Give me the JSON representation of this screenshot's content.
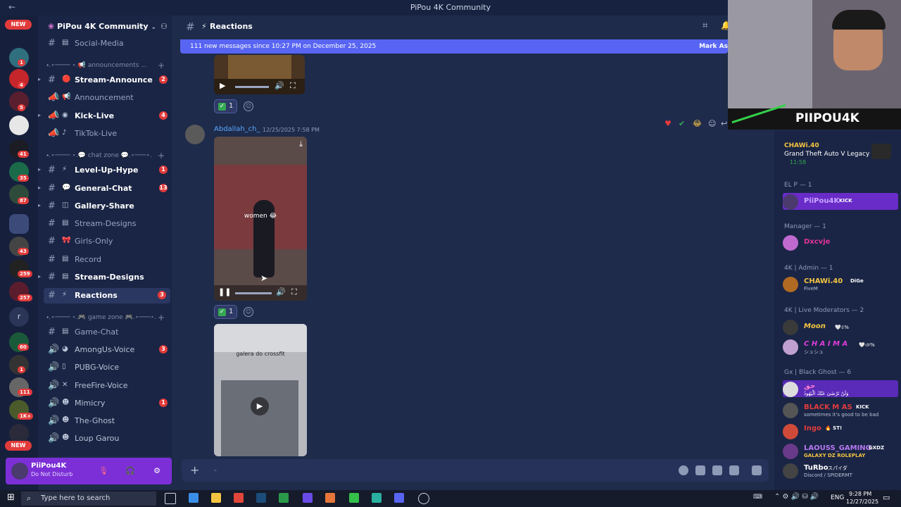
{
  "window": {
    "title": "PiPou 4K Community"
  },
  "server": {
    "name": "PiPou 4K Community"
  },
  "rail": {
    "new_label_top": "NEW",
    "new_label_bottom": "NEW",
    "badges": [
      "1",
      "4",
      "5",
      "41",
      "35",
      "87",
      "43",
      "259",
      "257",
      "60",
      "1",
      "111",
      "1K+"
    ],
    "letter": "r"
  },
  "channels": {
    "social": "Social-Media",
    "cat_announcements": "⬩.⋆──── ⋆.📢 announcements ...",
    "stream_announce": "Stream-Announce",
    "announcement": "Announcement",
    "kick_live": "Kick-Live",
    "tiktok_live": "TikTok-Live",
    "cat_chat": "⬩.⋆──── ⋆.💬 chat zone 💬.⋆───⋆.",
    "level_up": "Level-Up-Hype",
    "general_chat": "General-Chat",
    "gallery": "Gallery-Share",
    "stream_designs": "Stream-Designs",
    "girls_only": "Girls-Only",
    "record": "Record",
    "stream_designs2": "Stream-Designs",
    "reactions": "Reactions",
    "cat_game": "⬩.⋆──── ⋆.🎮 game zone 🎮.⋆───⋆.",
    "game_chat": "Game-Chat",
    "amongus": "AmongUs-Voice",
    "pubg": "PUBG-Voice",
    "freefire": "FreeFire-Voice",
    "mimicry": "Mimicry",
    "the_ghost": "The-Ghost",
    "loup": "Loup Garou",
    "badge_stream_announce": "2",
    "badge_kick": "4",
    "badge_level": "1",
    "badge_general": "13",
    "badge_reactions": "3",
    "badge_amongus": "3",
    "badge_mimicry": "1"
  },
  "user": {
    "name": "PiiPou4K",
    "status": "Do Not Disturb"
  },
  "header": {
    "channel": "Reactions"
  },
  "new_messages": {
    "text": "111 new messages since 10:27 PM on December 25, 2025",
    "action": "Mark As"
  },
  "messages": [
    {
      "reaction_count": "1"
    },
    {
      "author": "Abdallah_ch_",
      "timestamp": "12/25/2025 7:58 PM",
      "caption": "women 😂",
      "reaction_count": "1"
    },
    {
      "caption": "galera do crossfit"
    }
  ],
  "members": {
    "activity_user": "CHAWi.40",
    "activity_game": "Grand Theft Auto V Legacy",
    "activity_time": "11:58",
    "groups": {
      "elp": "EL P — 1",
      "manager": "Manager — 1",
      "admin": "4K | Admin — 1",
      "mods": "4K | Live Moderators — 2",
      "ghost": "Gx | Black Ghost — 6"
    },
    "elp_name": "PiiPou4K",
    "elp_tag": "KICK",
    "manager_name": "Dxcvje",
    "admin_name": "CHAWi.40",
    "admin_tag": "DiGe",
    "admin_sub": "FiveM",
    "mod1": "Moon",
    "mod1_tag": "🤍৪%",
    "mod2": "C H A I M A",
    "mod2_tag": "🤍ঞ%",
    "mod2_sub": "シュシュ",
    "g1": "حق",
    "g1_sub": "وَلَنْ تَرْضَىٰ عَنْكَ الْيَهُودُ",
    "g2": "BLACK M AS",
    "g2_tag": "KICK",
    "g2_sub": "sometimes it's good to be bad",
    "g3": "Ingo",
    "g3_tag": "🔥 ST!",
    "g4": "LAOUSS_GAMING",
    "g4_tag": "GXDZ",
    "g4_sub": "GALAXY DZ ROLEPLAY",
    "g5": "TuRbo",
    "g5_tag": "スパイダ",
    "g5_sub": "Discord / SPIDERMT"
  },
  "webcam": {
    "overlay": "PIIPOU4K"
  },
  "taskbar": {
    "search": "Type here to search",
    "lang": "ENG",
    "time": "9:28 PM",
    "date": "12/27/2025"
  },
  "colors": {
    "accent": "#5865f2",
    "badge": "#e23b3b",
    "member_hl": "#6a2cc8"
  }
}
